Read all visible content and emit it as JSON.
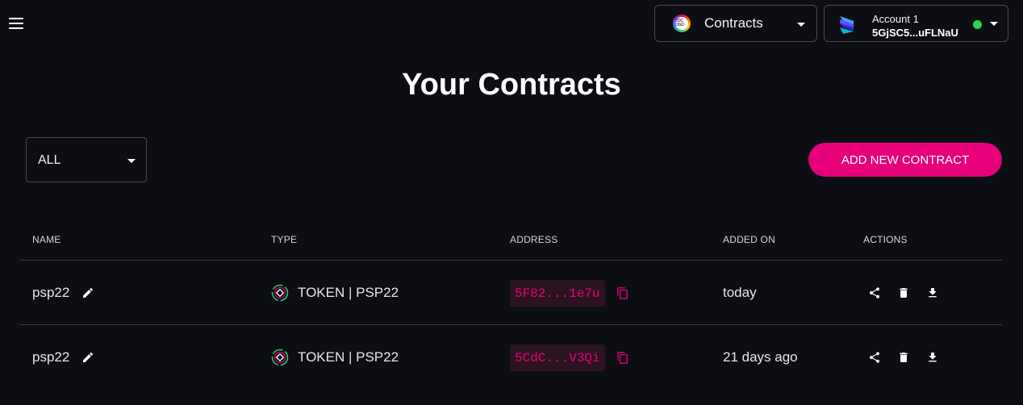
{
  "header": {
    "network": {
      "label": "Contracts",
      "logo_text": "ZOC OGO"
    },
    "account": {
      "name": "Account 1",
      "address": "5GjSC5...uFLNaU",
      "status_color": "#2ed34a"
    }
  },
  "page": {
    "title": "Your Contracts",
    "filter": {
      "value": "ALL"
    },
    "add_button_label": "ADD NEW CONTRACT"
  },
  "table": {
    "columns": [
      "NAME",
      "TYPE",
      "ADDRESS",
      "ADDED ON",
      "ACTIONS"
    ],
    "rows": [
      {
        "name": "psp22",
        "type": "TOKEN | PSP22",
        "address": "5F82...1e7u",
        "added_on": "today"
      },
      {
        "name": "psp22",
        "type": "TOKEN | PSP22",
        "address": "5CdC...V3Qi",
        "added_on": "21 days ago"
      }
    ],
    "actions": [
      "share-icon",
      "delete-icon",
      "download-icon"
    ]
  },
  "colors": {
    "accent": "#e6007a",
    "background": "#0d0e13"
  }
}
